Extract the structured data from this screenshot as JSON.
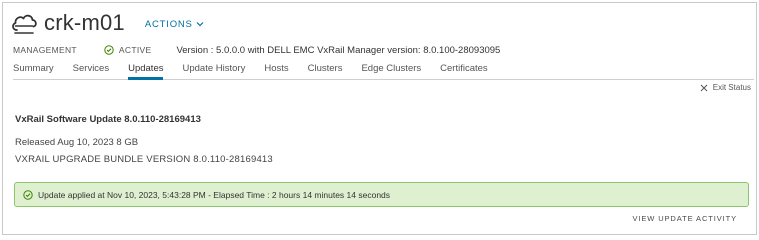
{
  "header": {
    "icon": "cloud-icon",
    "title": "crk-m01",
    "actions_label": "ACTIONS"
  },
  "meta": {
    "management_label": "MANAGEMENT",
    "status_label": "ACTIVE",
    "status_color": "#3c8500",
    "version_text": "Version : 5.0.0.0 with DELL EMC VxRail Manager version: 8.0.100-28093095"
  },
  "tabs": [
    {
      "label": "Summary",
      "active": false
    },
    {
      "label": "Services",
      "active": false
    },
    {
      "label": "Updates",
      "active": true
    },
    {
      "label": "Update History",
      "active": false
    },
    {
      "label": "Hosts",
      "active": false
    },
    {
      "label": "Clusters",
      "active": false
    },
    {
      "label": "Edge Clusters",
      "active": false
    },
    {
      "label": "Certificates",
      "active": false
    }
  ],
  "exit_status_label": "Exit Status",
  "update": {
    "title": "VxRail Software Update 8.0.110-28169413",
    "released": "Released Aug 10, 2023 8 GB",
    "bundle": "VXRAIL UPGRADE BUNDLE VERSION 8.0.110-28169413"
  },
  "alert": {
    "message": "Update applied at Nov 10, 2023, 5:43:28 PM - Elapsed Time : 2 hours 14 minutes 14 seconds",
    "background": "#dff0d0",
    "border": "#8cc56a"
  },
  "view_update_activity_label": "VIEW UPDATE ACTIVITY",
  "accent_color": "#0072a3"
}
